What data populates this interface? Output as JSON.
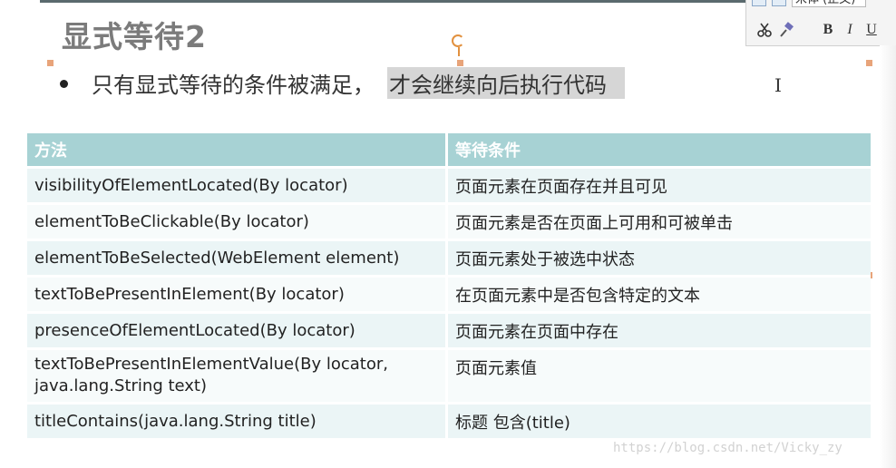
{
  "slide": {
    "title": "显式等待2",
    "bullet_prefix": "只有显式等待的条件被满足，",
    "bullet_highlight": "才会继续向后执行代码"
  },
  "toolbar": {
    "font_name": "宋体 (正文)",
    "bold_label": "B",
    "italic_label": "I",
    "underline_label": "U",
    "icons": [
      "paste-icon",
      "format-icon",
      "scissors-icon",
      "format-painter-icon"
    ]
  },
  "table": {
    "headers": [
      "方法",
      "等待条件"
    ],
    "rows": [
      {
        "method": "visibilityOfElementLocated(By locator)",
        "condition": "页面元素在页面存在并且可见"
      },
      {
        "method": "elementToBeClickable(By locator)",
        "condition": "页面元素是否在页面上可用和可被单击"
      },
      {
        "method": "elementToBeSelected(WebElement element)",
        "condition": "页面元素处于被选中状态"
      },
      {
        "method": "textToBePresentInElement(By locator)",
        "condition": "在页面元素中是否包含特定的文本"
      },
      {
        "method": "presenceOfElementLocated(By locator)",
        "condition": "页面元素在页面中存在"
      },
      {
        "method": "textToBePresentInElementValue(By locator,",
        "method_line2": "java.lang.String text)",
        "condition": "页面元素值"
      },
      {
        "method": "titleContains(java.lang.String title)",
        "condition": "标题 包含(title)"
      }
    ]
  },
  "watermark": "https://blog.csdn.net/Vicky_zy",
  "colors": {
    "header_bg": "#a7d2d4",
    "row_odd": "#ebf5f6",
    "row_even": "#f7fbfb",
    "handle": "#e8a47a",
    "selection_highlight": "#d6d6d6"
  }
}
